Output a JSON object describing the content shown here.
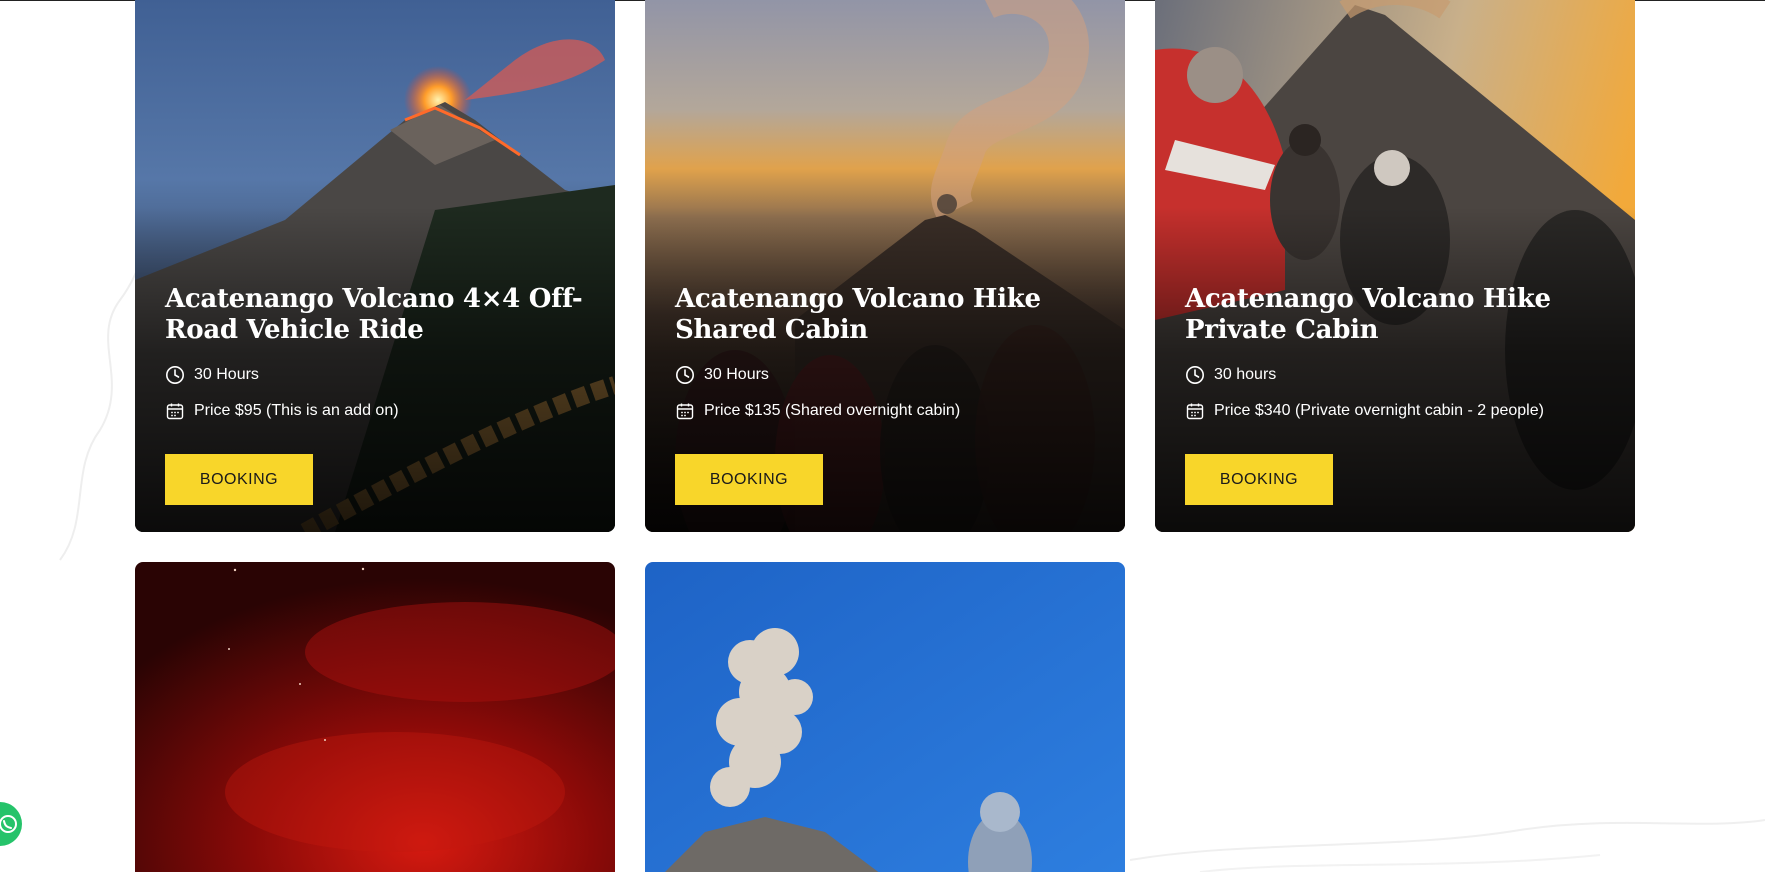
{
  "tours": [
    {
      "title": "Acatenango Volcano 4×4 Off-Road Vehicle Ride",
      "duration": "30 Hours",
      "price": "Price $95 (This is an add on)",
      "button": "BOOKING"
    },
    {
      "title": "Acatenango Volcano Hike Shared Cabin",
      "duration": "30 Hours",
      "price": "Price $135 (Shared overnight cabin)",
      "button": "BOOKING"
    },
    {
      "title": "Acatenango Volcano Hike Private Cabin",
      "duration": "30 hours",
      "price": "Price $340 (Private overnight cabin - 2 people)",
      "button": "BOOKING"
    }
  ],
  "icons": {
    "duration": "clock-icon",
    "price": "calendar-icon",
    "chat": "whatsapp-icon"
  },
  "colors": {
    "button_bg": "#f8d62a",
    "button_text": "#1a1a1a",
    "title_text": "#ffffff",
    "chat_green": "#25c36a"
  }
}
